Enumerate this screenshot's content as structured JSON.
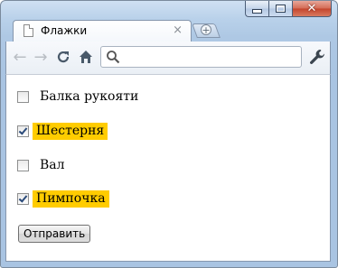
{
  "window": {
    "tab_title": "Флажки",
    "tab_close_glyph": "×",
    "new_tab_glyph": "+"
  },
  "toolbar": {
    "back_glyph": "←",
    "forward_glyph": "→",
    "reload_glyph": "C",
    "home_glyph": "⌂",
    "address_value": "",
    "address_placeholder": ""
  },
  "form": {
    "items": [
      {
        "label": "Балка рукояти",
        "checked": false,
        "highlighted": false
      },
      {
        "label": "Шестерня",
        "checked": true,
        "highlighted": true
      },
      {
        "label": "Вал",
        "checked": false,
        "highlighted": false
      },
      {
        "label": "Пимпочка",
        "checked": true,
        "highlighted": true
      }
    ],
    "submit_label": "Отправить"
  },
  "colors": {
    "highlight": "#ffcc00",
    "frame": "#b9d1ea"
  }
}
